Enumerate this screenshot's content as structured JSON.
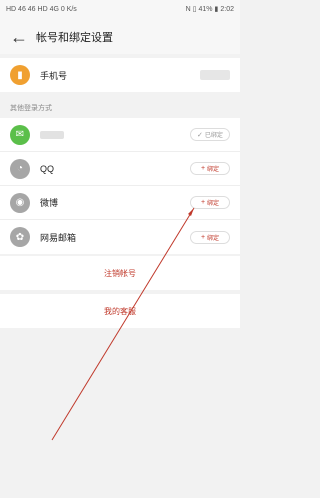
{
  "status_bar": {
    "left": "HD 46 46 HD 4G 0 K/s",
    "battery": "41%",
    "time": "2:02"
  },
  "header": {
    "title": "帐号和绑定设置"
  },
  "phone": {
    "label": "手机号"
  },
  "other_login": {
    "title": "其他登录方式",
    "items": [
      {
        "name": "",
        "button": "已绑定",
        "icon": "wechat-icon",
        "color": "#5bbf4a"
      },
      {
        "name": "QQ",
        "button": "绑定",
        "icon": "qq-icon",
        "color": "#a6a6a6"
      },
      {
        "name": "微博",
        "button": "绑定",
        "icon": "weibo-icon",
        "color": "#a6a6a6"
      },
      {
        "name": "网易邮箱",
        "button": "绑定",
        "icon": "netease-mail-icon",
        "color": "#a6a6a6"
      }
    ]
  },
  "actions": {
    "deactivate": "注销帐号",
    "service": "我的客服"
  },
  "colors": {
    "accent": "#c0392b",
    "phone_icon": "#f0a030"
  }
}
